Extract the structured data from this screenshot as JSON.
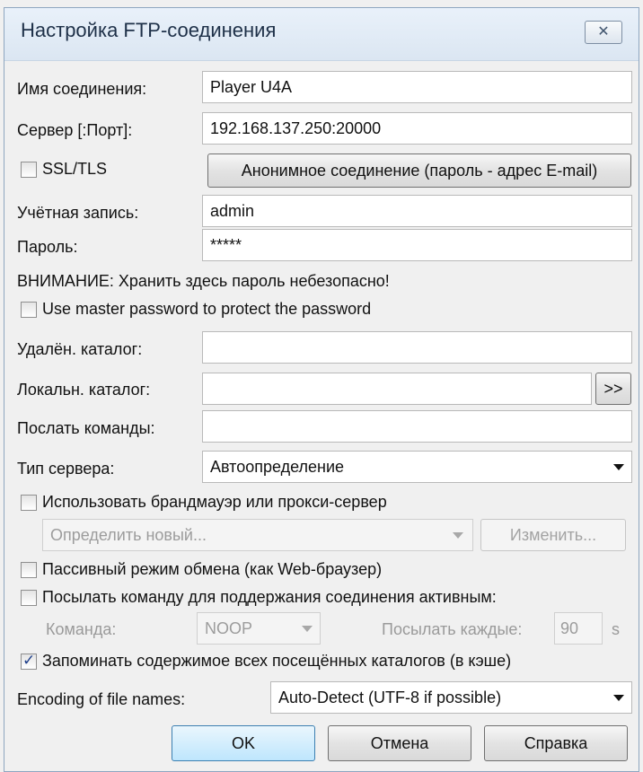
{
  "window": {
    "title": "Настройка FTP-соединения",
    "close_glyph": "✕"
  },
  "connection_name": {
    "label": "Имя соединения:",
    "value": "Player U4A"
  },
  "server": {
    "label": "Сервер [:Порт]:",
    "value": "192.168.137.250:20000"
  },
  "ssl": {
    "label": "SSL/TLS",
    "checked": false
  },
  "anonymous_button": "Анонимное соединение (пароль - адрес E-mail)",
  "account": {
    "label": "Учётная запись:",
    "value": "admin"
  },
  "password": {
    "label": "Пароль:",
    "value": "*****"
  },
  "warning": "ВНИМАНИЕ: Хранить здесь пароль небезопасно!",
  "master_password": {
    "label": "Use master password to protect the password",
    "checked": false
  },
  "remote_dir": {
    "label": "Удалён. каталог:",
    "value": ""
  },
  "local_dir": {
    "label": "Локальн. каталог:",
    "value": "",
    "browse_label": ">>"
  },
  "send_commands": {
    "label": "Послать команды:",
    "value": ""
  },
  "server_type": {
    "label": "Тип сервера:",
    "value": "Автоопределение"
  },
  "firewall": {
    "label": "Использовать брандмауэр или прокси-сервер",
    "checked": false,
    "select_value": "Определить новый...",
    "change_label": "Изменить..."
  },
  "passive": {
    "label": "Пассивный режим обмена (как Web-браузер)",
    "checked": false
  },
  "keepalive": {
    "label": "Посылать команду для поддержания соединения активным:",
    "checked": false,
    "command_label": "Команда:",
    "command_value": "NOOP",
    "interval_label": "Посылать каждые:",
    "interval_value": "90",
    "interval_unit": "s"
  },
  "cache": {
    "label": "Запоминать содержимое всех посещённых каталогов (в кэше)",
    "checked": true
  },
  "encoding": {
    "label": "Encoding of file names:",
    "value": "Auto-Detect (UTF-8 if possible)"
  },
  "buttons": {
    "ok": "OK",
    "cancel": "Отмена",
    "help": "Справка"
  },
  "colors": {
    "title_bar": "#dbe6f2",
    "checkmark": "#1d3e8a",
    "default_button": "#bee6fd"
  }
}
